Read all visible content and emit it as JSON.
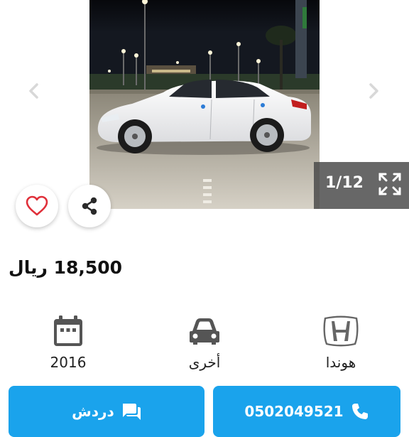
{
  "gallery": {
    "counter": "1/12",
    "prev_icon": "chevron-left-icon",
    "next_icon": "chevron-right-icon",
    "fullscreen_icon": "fullscreen-icon"
  },
  "actions": {
    "favorite_icon": "heart-icon",
    "share_icon": "share-icon"
  },
  "listing": {
    "price": "18,500 ريال"
  },
  "specs": {
    "year": "2016",
    "body_type": "أخرى",
    "make": "هوندا"
  },
  "buttons": {
    "chat_label": "دردش",
    "phone": "0502049521"
  },
  "colors": {
    "primary": "#1aa3ec",
    "favorite": "#e0303a",
    "overlay": "#464646"
  }
}
